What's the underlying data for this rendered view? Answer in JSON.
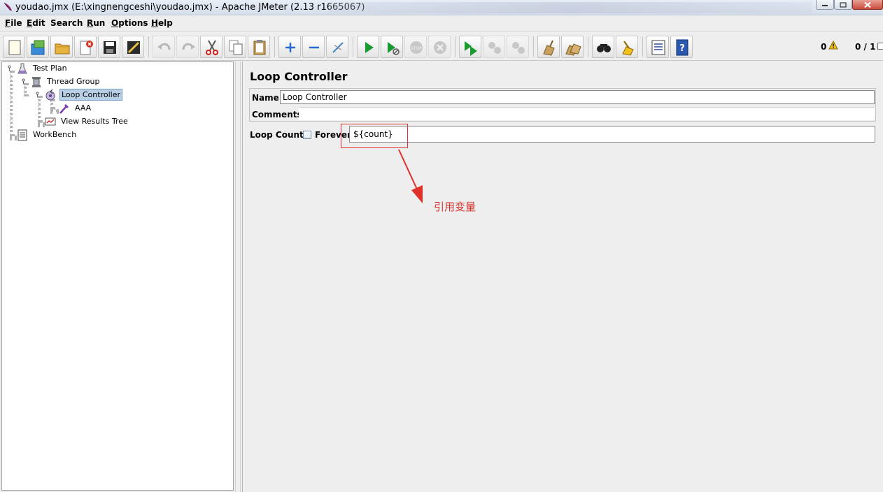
{
  "window": {
    "title": "youdao.jmx (E:\\xingnengceshi\\youdao.jmx) - Apache JMeter (2.13 r1665067)"
  },
  "menu": [
    {
      "label": "File",
      "mnemonic": "F",
      "rest": "ile"
    },
    {
      "label": "Edit",
      "mnemonic": "E",
      "rest": "dit"
    },
    {
      "label": "Search",
      "mnemonic": "S",
      "rest": "earch"
    },
    {
      "label": "Run",
      "mnemonic": "R",
      "rest": "un"
    },
    {
      "label": "Options",
      "mnemonic": "O",
      "rest": "ptions"
    },
    {
      "label": "Help",
      "mnemonic": "H",
      "rest": "elp"
    }
  ],
  "toolbar": {
    "buttons": [
      "new",
      "templates",
      "open",
      "close",
      "save",
      "save-as-image",
      "undo",
      "redo",
      "cut",
      "copy",
      "paste",
      "expand-all",
      "collapse-all",
      "toggle",
      "start",
      "start-no-pauses",
      "stop",
      "shutdown",
      "remote-start-all",
      "remote-stop-all",
      "remote-shutdown-all",
      "clear",
      "clear-all",
      "search",
      "reset-search",
      "function-helper",
      "help"
    ],
    "error_count": "0",
    "thread_status": "0 / 1"
  },
  "tree": {
    "test_plan": "Test Plan",
    "thread_group": "Thread Group",
    "loop_controller": "Loop Controller",
    "sampler": "AAA",
    "listener": "View Results Tree",
    "workbench": "WorkBench"
  },
  "panel": {
    "title": "Loop Controller",
    "name_label": "Name:",
    "name_value": "Loop Controller",
    "comments_label": "Comments:",
    "loop_count_label": "Loop Count:",
    "forever_label": "Forever",
    "forever_checked": false,
    "loop_count_value": "${count}"
  },
  "annotation": {
    "text": "引用变量",
    "color": "#d6322c"
  }
}
